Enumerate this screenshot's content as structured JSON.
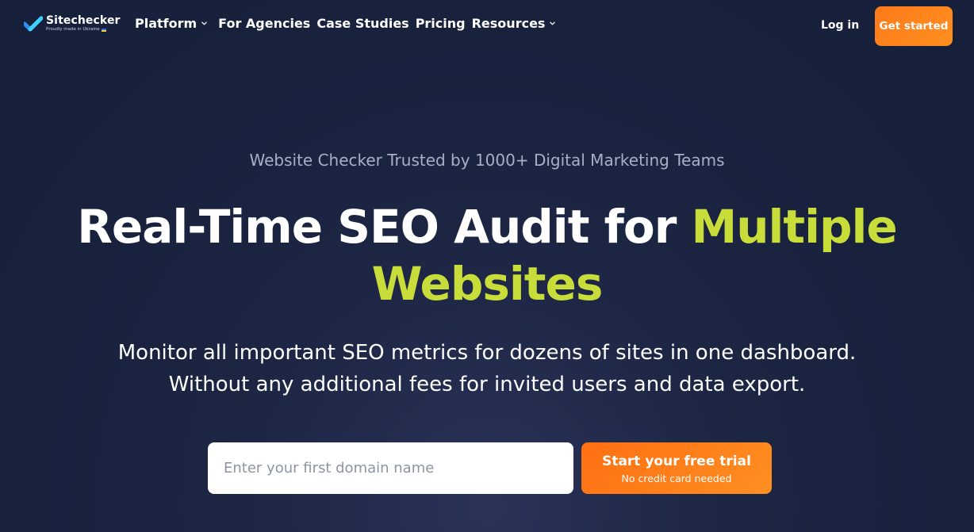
{
  "header": {
    "logo": {
      "name": "Sitechecker",
      "tagline": "Proudly made in Ukraine"
    },
    "nav": [
      {
        "label": "Platform",
        "has_dropdown": true
      },
      {
        "label": "For Agencies",
        "has_dropdown": false
      },
      {
        "label": "Case Studies",
        "has_dropdown": false
      },
      {
        "label": "Pricing",
        "has_dropdown": false
      },
      {
        "label": "Resources",
        "has_dropdown": true
      }
    ],
    "login_label": "Log in",
    "cta_label": "Get started"
  },
  "hero": {
    "kicker": "Website Checker Trusted by 1000+ Digital Marketing Teams",
    "headline_plain": "Real-Time SEO Audit for ",
    "headline_accent": "Multiple Websites",
    "subtitle_line1": "Monitor all important SEO metrics for dozens of sites in one dashboard.",
    "subtitle_line2": "Without any additional fees for invited users and data export."
  },
  "form": {
    "domain_placeholder": "Enter your first domain name",
    "domain_value": "",
    "button_label": "Start your free trial",
    "button_sublabel": "No credit card needed"
  },
  "colors": {
    "background": "#18223d",
    "accent_green": "#c8dc3a",
    "cta_orange": "#ff7a1a",
    "kicker_gray": "#a9afc4"
  },
  "icons": {
    "logo": "sitechecker-logo-icon",
    "dropdown": "chevron-down-icon"
  }
}
